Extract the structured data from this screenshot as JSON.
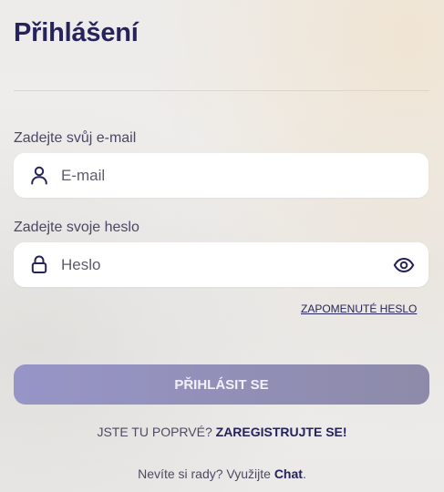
{
  "page": {
    "title": "Přihlášení"
  },
  "email": {
    "label": "Zadejte svůj e-mail",
    "placeholder": "E-mail",
    "value": "",
    "icon": "user-icon"
  },
  "password": {
    "label": "Zadejte svoje heslo",
    "placeholder": "Heslo",
    "value": "",
    "icon": "lock-icon",
    "toggle_icon": "eye-icon"
  },
  "forgot_password": {
    "label": "ZAPOMENUTÉ HESLO"
  },
  "login_button": {
    "label": "PŘIHLÁSIT SE"
  },
  "register": {
    "prompt": "JSTE TU POPRVÉ?",
    "link": "ZAREGISTRUJTE SE!"
  },
  "help": {
    "prompt": "Nevíte si rady? Využijte",
    "link": "Chat",
    "suffix": "."
  },
  "colors": {
    "title": "#25235a",
    "button_start": "#9795c7",
    "button_end": "#8d8aa9",
    "link": "#25235a"
  }
}
